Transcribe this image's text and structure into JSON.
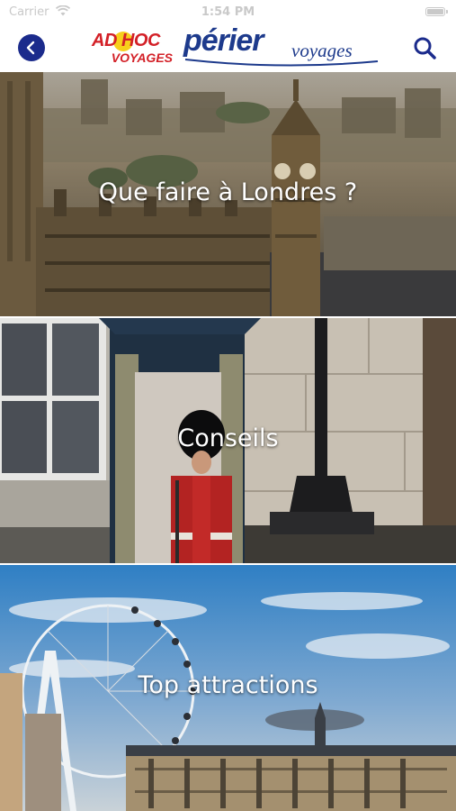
{
  "status_bar": {
    "carrier": "Carrier",
    "time": "1:54 PM"
  },
  "header": {
    "logo_adhoc_top": "AD HOC",
    "logo_adhoc_bottom": "VOYAGES",
    "logo_perier": "périer",
    "logo_perier_voyages": "voyages"
  },
  "cards": [
    {
      "title": "Que faire à Londres ?"
    },
    {
      "title": "Conseils"
    },
    {
      "title": "Top attractions"
    }
  ],
  "colors": {
    "nav_icon": "#1b2b8c",
    "adhoc_red": "#d32027",
    "perier_blue": "#1d3a8c"
  },
  "icons": {
    "back": "chevron-left-icon",
    "search": "search-icon",
    "wifi": "wifi-icon",
    "battery": "battery-icon"
  }
}
